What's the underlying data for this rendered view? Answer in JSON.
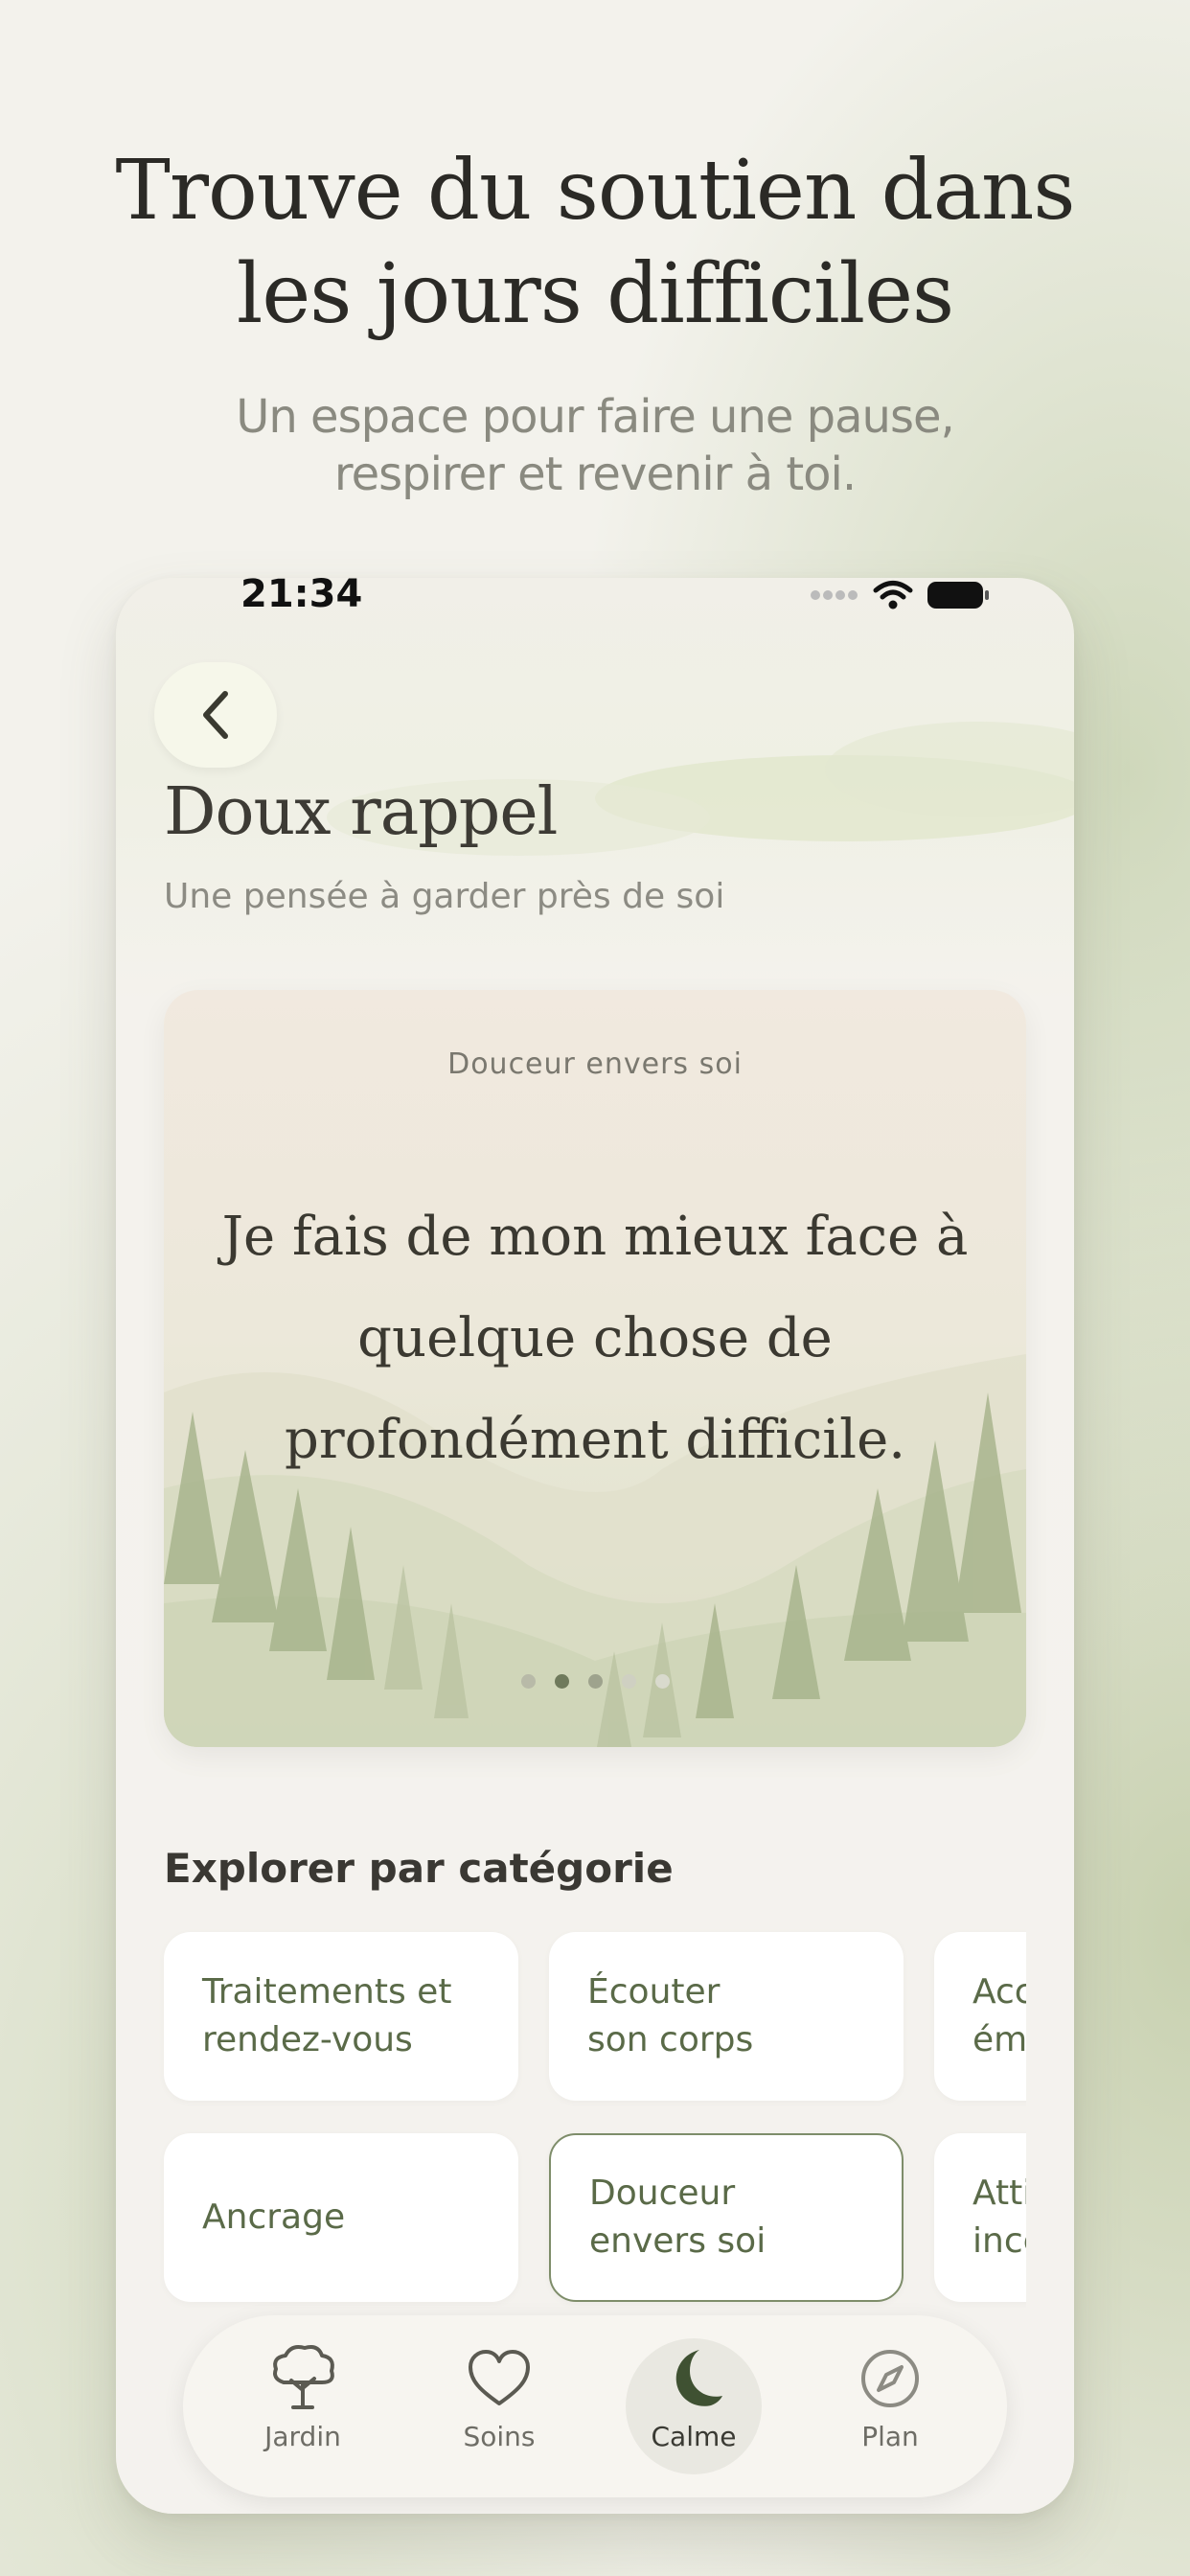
{
  "hero": {
    "title_line1": "Trouve du soutien dans",
    "title_line2": "les jours difficiles",
    "subtitle_line1": "Un espace pour faire une pause,",
    "subtitle_line2": "respirer et revenir à toi."
  },
  "status_bar": {
    "time": "21:34"
  },
  "page": {
    "title": "Doux rappel",
    "subtitle": "Une pensée à garder près de soi"
  },
  "reminder_card": {
    "category": "Douceur envers soi",
    "quote": "Je fais de mon mieux face à quelque chose de profondément difficile.",
    "page_count": 5,
    "active_page": 2
  },
  "categories": {
    "title": "Explorer par catégorie",
    "row1": [
      "Traitements et\nrendez-vous",
      "Écouter\nson corps",
      "Accueillir\némotions"
    ],
    "row2": [
      "Ancrage",
      "Douceur\nenvers soi",
      "Attitude\nincertitude"
    ],
    "selected": "Douceur envers soi"
  },
  "tabbar": {
    "tabs": [
      {
        "label": "Jardin",
        "icon": "tree-icon"
      },
      {
        "label": "Soins",
        "icon": "heart-icon"
      },
      {
        "label": "Calme",
        "icon": "moon-icon"
      },
      {
        "label": "Plan",
        "icon": "compass-icon"
      }
    ],
    "active": "Calme"
  },
  "colors": {
    "accent_green": "#3f5132",
    "text_dark": "#2b2a26",
    "chip_text": "#5a6a48",
    "background": "#f3f2ec"
  }
}
